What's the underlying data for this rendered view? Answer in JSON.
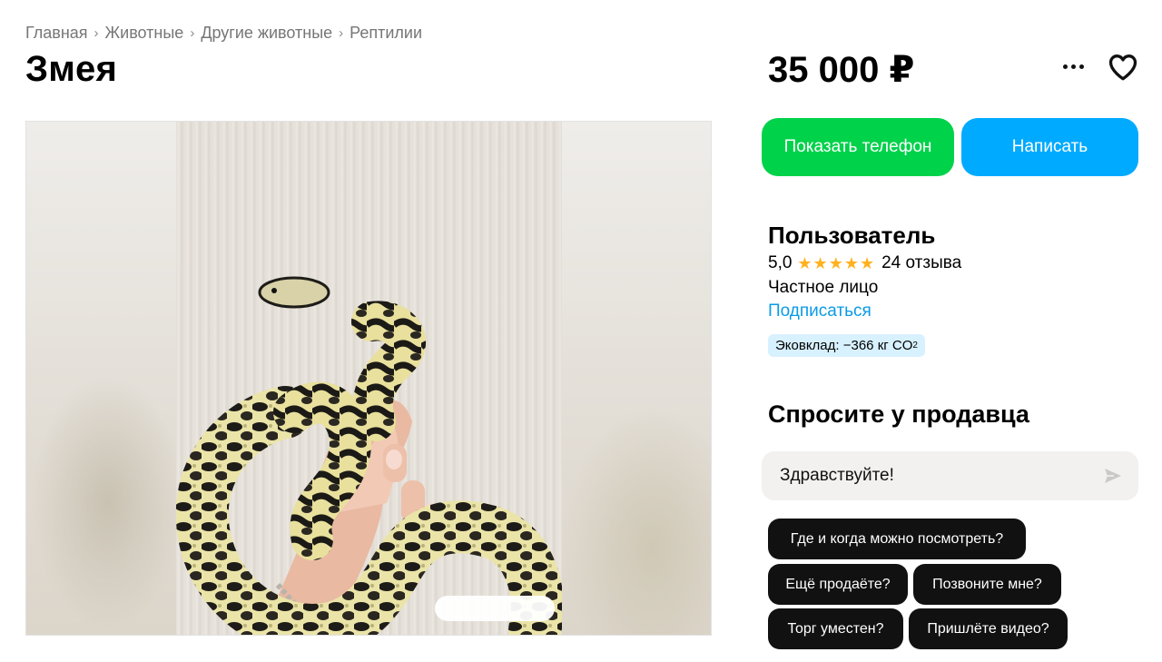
{
  "breadcrumb": {
    "items": [
      "Главная",
      "Животные",
      "Другие животные",
      "Рептилии"
    ],
    "separator": "›"
  },
  "listing": {
    "title": "Змея",
    "price": "35 000 ₽"
  },
  "actions": {
    "more_icon": "more-horizontal-icon",
    "favorite_icon": "heart-icon",
    "show_phone_label": "Показать телефон",
    "write_label": "Написать",
    "phone_color": "#00d24a",
    "write_color": "#00aaff"
  },
  "seller": {
    "name": "Пользователь",
    "rating": "5,0",
    "stars": "★★★★★",
    "star_count": 5,
    "reviews": "24 отзыва",
    "type": "Частное лицо",
    "subscribe_label": "Подписаться",
    "eco_label": "Эковклад: −366 кг CO",
    "eco_sub": "2"
  },
  "ask": {
    "title": "Спросите у продавца",
    "message_value": "Здравствуйте!",
    "send_icon": "send-icon",
    "quick_questions": [
      "Где и когда можно посмотреть?",
      "Ещё продаёте?",
      "Позвоните мне?",
      "Торг уместен?",
      "Пришлёте видео?"
    ]
  },
  "gallery": {
    "image_subject": "snake-photo"
  }
}
